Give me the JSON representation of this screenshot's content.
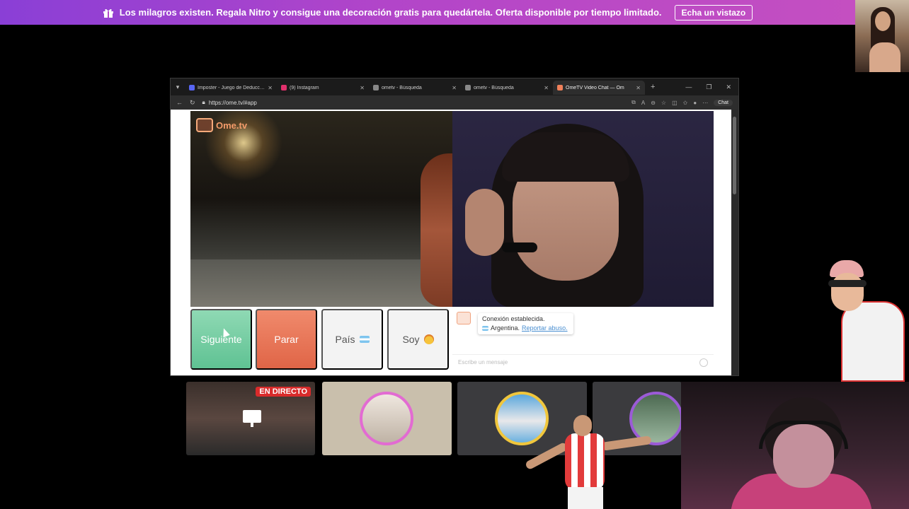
{
  "banner": {
    "text": "Los milagros existen. Regala Nitro y consigue una decoración gratis para quedártela. Oferta disponible por tiempo limitado.",
    "button_label": "Echa un vistazo",
    "gradient_start": "#8a3fd6",
    "gradient_end": "#c44fc1"
  },
  "browser": {
    "tabs": [
      {
        "title": "Imposter - Juego de Deducción",
        "favicon_color": "#5865f2",
        "active": false
      },
      {
        "title": "(9) Instagram",
        "favicon_color": "#e1306c",
        "active": false
      },
      {
        "title": "ometv - Búsqueda",
        "favicon_color": "#888888",
        "active": false
      },
      {
        "title": "ometv - Búsqueda",
        "favicon_color": "#888888",
        "active": false
      },
      {
        "title": "OmeTV Video Chat — Om",
        "favicon_color": "#f0805a",
        "active": true
      }
    ],
    "url": "https://ome.tv/#app",
    "chat_button_label": "Chat"
  },
  "ometv": {
    "logo_text": "Ome.tv",
    "buttons": {
      "next": "Siguiente",
      "stop": "Parar",
      "country": "País",
      "me": "Soy"
    },
    "chat": {
      "status": "Conexión establecida.",
      "country": "Argentina.",
      "report_link": "Reportar abuso.",
      "input_placeholder": "Escribe un mensaje"
    },
    "colors": {
      "next": "#5fc293",
      "stop": "#e06547",
      "brand": "#f39b6a"
    }
  },
  "stream_cards": [
    {
      "badge": "EN DIRECTO",
      "ring_color": ""
    },
    {
      "badge": "",
      "ring_color": "#e26bd2"
    },
    {
      "badge": "",
      "ring_color": "#f0c63c"
    },
    {
      "badge": "",
      "ring_color": "#9b5bd6"
    }
  ]
}
